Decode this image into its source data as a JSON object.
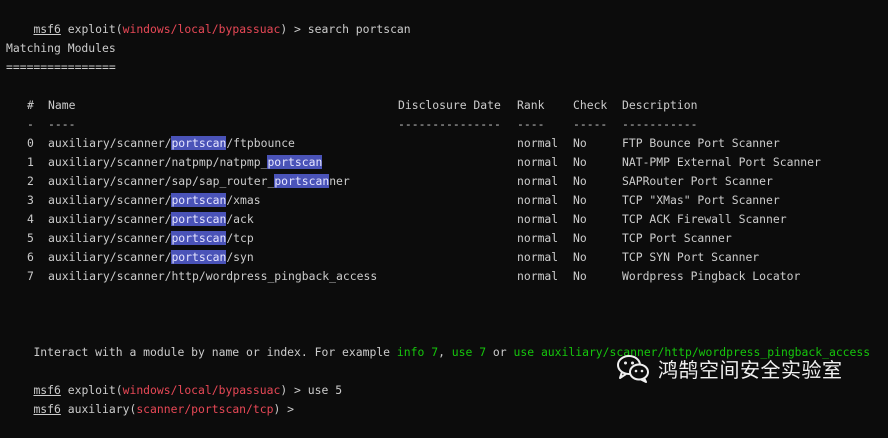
{
  "prompt1": {
    "prefix": "msf6",
    "mid1": " exploit(",
    "module": "windows/local/bypassuac",
    "mid2": ") > ",
    "command": "search portscan"
  },
  "section_title": "Matching Modules",
  "section_rule": "================",
  "table": {
    "headers": {
      "num": "#",
      "name": "Name",
      "date": "Disclosure Date",
      "rank": "Rank",
      "check": "Check",
      "desc": "Description"
    },
    "dividers": {
      "num": "-",
      "name": "----",
      "date": "---------------",
      "rank": "----",
      "check": "-----",
      "desc": "-----------"
    },
    "rows": [
      {
        "num": "0",
        "pre": "auxiliary/scanner/",
        "hl": "portscan",
        "post": "/ftpbounce",
        "date": "",
        "rank": "normal",
        "check": "No",
        "desc": "FTP Bounce Port Scanner"
      },
      {
        "num": "1",
        "pre": "auxiliary/scanner/natpmp/natpmp_",
        "hl": "portscan",
        "post": "",
        "date": "",
        "rank": "normal",
        "check": "No",
        "desc": "NAT-PMP External Port Scanner"
      },
      {
        "num": "2",
        "pre": "auxiliary/scanner/sap/sap_router_",
        "hl": "portscan",
        "post": "ner",
        "date": "",
        "rank": "normal",
        "check": "No",
        "desc": "SAPRouter Port Scanner"
      },
      {
        "num": "3",
        "pre": "auxiliary/scanner/",
        "hl": "portscan",
        "post": "/xmas",
        "date": "",
        "rank": "normal",
        "check": "No",
        "desc": "TCP \"XMas\" Port Scanner"
      },
      {
        "num": "4",
        "pre": "auxiliary/scanner/",
        "hl": "portscan",
        "post": "/ack",
        "date": "",
        "rank": "normal",
        "check": "No",
        "desc": "TCP ACK Firewall Scanner"
      },
      {
        "num": "5",
        "pre": "auxiliary/scanner/",
        "hl": "portscan",
        "post": "/tcp",
        "date": "",
        "rank": "normal",
        "check": "No",
        "desc": "TCP Port Scanner"
      },
      {
        "num": "6",
        "pre": "auxiliary/scanner/",
        "hl": "portscan",
        "post": "/syn",
        "date": "",
        "rank": "normal",
        "check": "No",
        "desc": "TCP SYN Port Scanner"
      },
      {
        "num": "7",
        "pre": "auxiliary/scanner/http/wordpress_pingback_access",
        "hl": "",
        "post": "",
        "date": "",
        "rank": "normal",
        "check": "No",
        "desc": "Wordpress Pingback Locator"
      }
    ]
  },
  "interact_line": {
    "text1": "Interact with a module by name or index. For example ",
    "g1": "info 7",
    "text2": ", ",
    "g2": "use 7",
    "text3": " or ",
    "g3": "use auxiliary/scanner/http/wordpress_pingback_access"
  },
  "prompt2": {
    "prefix": "msf6",
    "mid1": " exploit(",
    "module": "windows/local/bypassuac",
    "mid2": ") > ",
    "command": "use 5"
  },
  "prompt3": {
    "prefix": "msf6",
    "mid1": " auxiliary(",
    "module": "scanner/portscan/tcp",
    "mid2": ") > ",
    "command": ""
  },
  "watermark": {
    "text": "鸿鹄空间安全实验室",
    "icon": "wechat-icon"
  },
  "colors": {
    "background": "#0c0c0c",
    "text": "#cccccc",
    "module_red": "#e74856",
    "hint_green": "#16c60c",
    "highlight": "#4a53b8"
  }
}
